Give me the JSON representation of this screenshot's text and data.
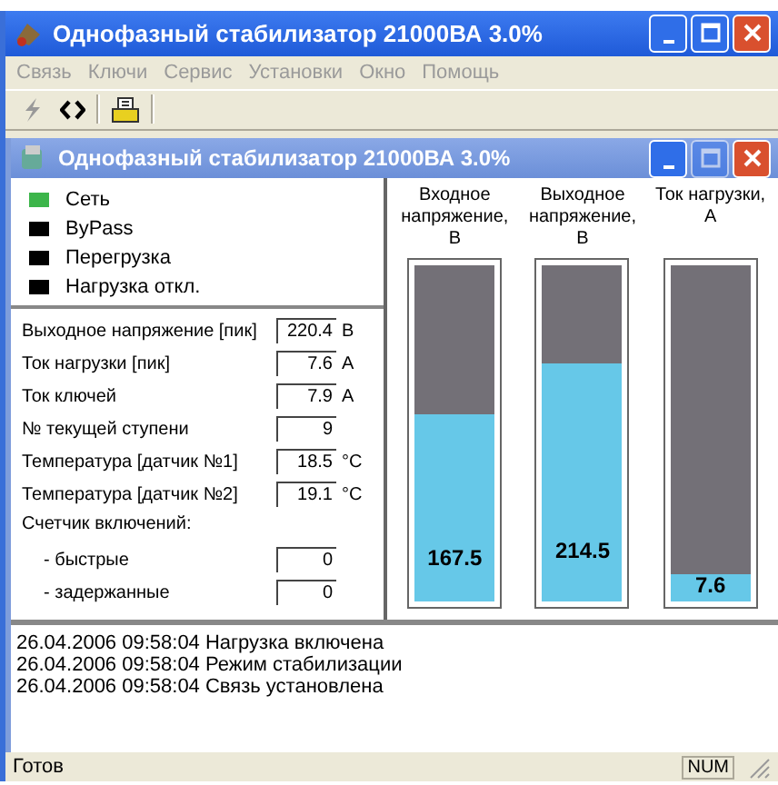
{
  "window": {
    "title": "Однофазный стабилизатор 21000ВА 3.0%"
  },
  "menu": [
    "Связь",
    "Ключи",
    "Сервис",
    "Установки",
    "Окно",
    "Помощь"
  ],
  "child_window": {
    "title": "Однофазный стабилизатор 21000ВА 3.0%"
  },
  "indicators": [
    {
      "label": "Сеть",
      "color": "#3cb54a"
    },
    {
      "label": "ByPass",
      "color": "#000000"
    },
    {
      "label": "Перегрузка",
      "color": "#000000"
    },
    {
      "label": "Нагрузка откл.",
      "color": "#000000"
    }
  ],
  "readings": [
    {
      "label": "Выходное напряжение [пик]",
      "value": "220.4",
      "unit": "В"
    },
    {
      "label": "Ток нагрузки [пик]",
      "value": "7.6",
      "unit": "А"
    },
    {
      "label": "Ток ключей",
      "value": "7.9",
      "unit": "А"
    },
    {
      "label": "№ текущей ступени",
      "value": "9"
    },
    {
      "label": "Температура [датчик №1]",
      "value": "18.5",
      "unit": "°C"
    },
    {
      "label": "Температура [датчик №2]",
      "value": "19.1",
      "unit": "°C"
    }
  ],
  "counter": {
    "title": "Счетчик включений:",
    "items": [
      {
        "label": "- быстрые",
        "value": "0"
      },
      {
        "label": "- задержанные",
        "value": "0"
      }
    ]
  },
  "gauges": [
    {
      "title": "Входное напряжение, В",
      "level": 0.56,
      "reading": "167.5"
    },
    {
      "title": "Выходное напряжение, В",
      "level": 0.71,
      "reading": "214.5"
    },
    {
      "title": "Ток нагрузки, А",
      "level": 0.08,
      "reading": "7.6"
    }
  ],
  "log": [
    "26.04.2006 09:58:04 Нагрузка включена",
    "26.04.2006 09:58:04 Режим стабилизации",
    "26.04.2006 09:58:04 Связь установлена"
  ],
  "status_bar": {
    "text": "Готов",
    "indicator": "NUM"
  }
}
